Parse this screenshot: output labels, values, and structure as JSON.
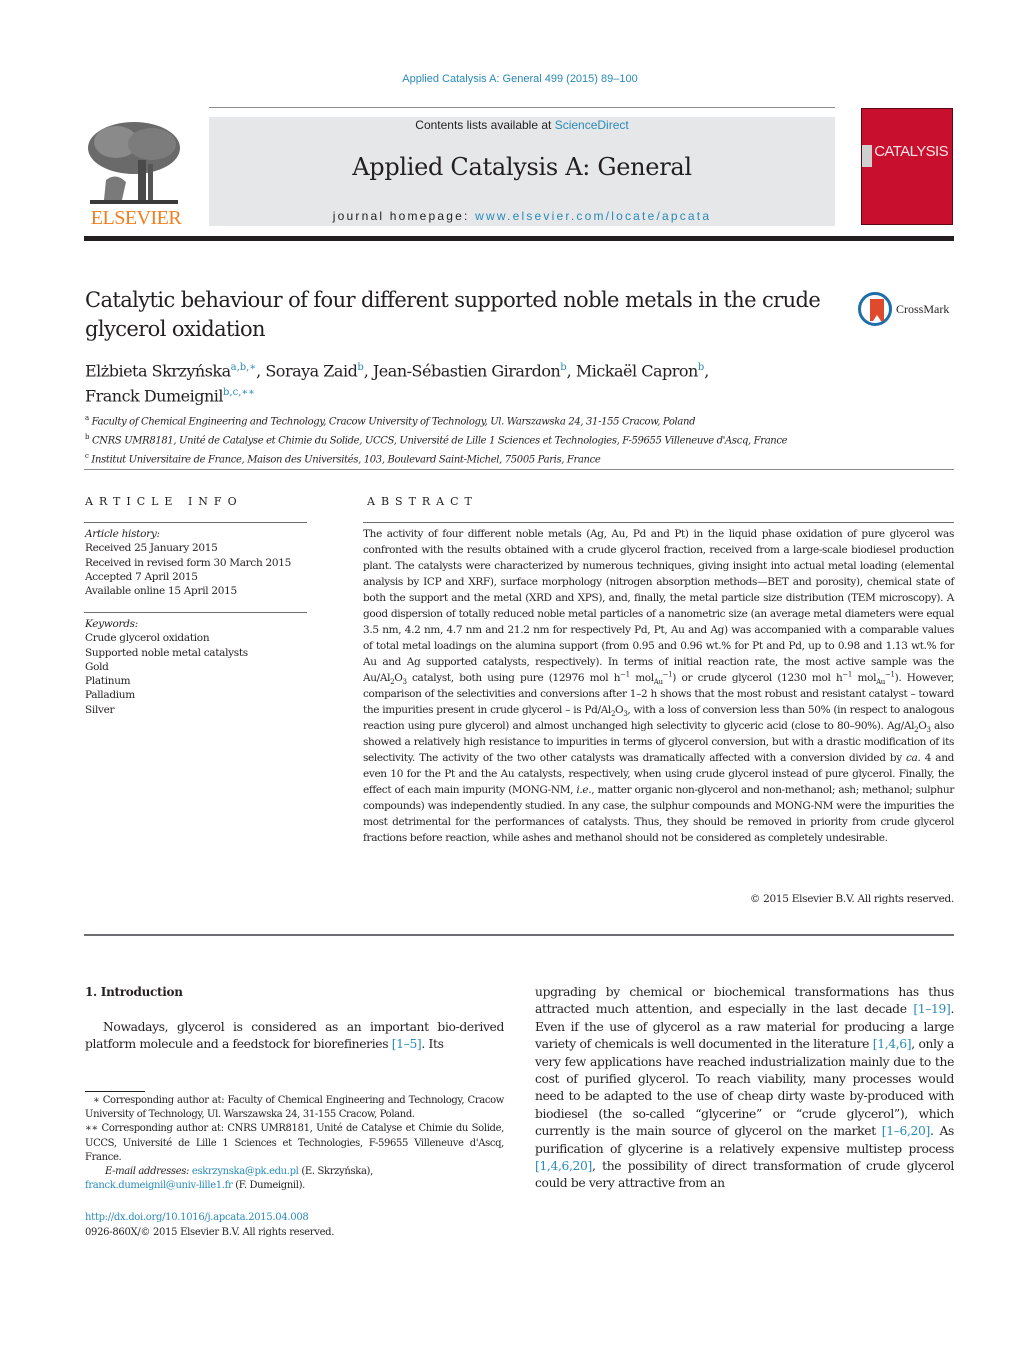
{
  "header": {
    "citation": "Applied Catalysis A: General 499 (2015) 89–100",
    "contents_prefix": "Contents lists available at ",
    "contents_link": "ScienceDirect",
    "journal_name": "Applied Catalysis A: General",
    "homepage_prefix": "journal homepage: ",
    "homepage_link": "www.elsevier.com/locate/apcata",
    "publisher_logo_text": "ELSEVIER",
    "cover_title": "CATALYSIS",
    "crossmark_label": "CrossMark"
  },
  "colors": {
    "link": "#2a8ab8",
    "elsevier_orange": "#f07f1d",
    "cover_red": "#c8102e",
    "band_gray": "#e6e7e8"
  },
  "article": {
    "title": "Catalytic behaviour of four different supported noble metals in the crude glycerol oxidation",
    "authors": [
      {
        "name": "Elżbieta Skrzyńska",
        "marks": "a,b,∗",
        "sep": ", "
      },
      {
        "name": "Soraya Zaid",
        "marks": "b",
        "sep": ", "
      },
      {
        "name": "Jean-Sébastien Girardon",
        "marks": "b",
        "sep": ", "
      },
      {
        "name": "Mickaël Capron",
        "marks": "b",
        "sep": ","
      },
      {
        "name": "Franck Dumeignil",
        "marks": "b,c,∗∗",
        "sep": ""
      }
    ],
    "affiliations": [
      {
        "mark": "a",
        "text": "Faculty of Chemical Engineering and Technology, Cracow University of Technology, Ul. Warszawska 24, 31-155 Cracow, Poland"
      },
      {
        "mark": "b",
        "text": "CNRS UMR8181, Unité de Catalyse et Chimie du Solide, UCCS, Université de Lille 1 Sciences et Technologies, F-59655 Villeneuve d'Ascq, France"
      },
      {
        "mark": "c",
        "text": "Institut Universitaire de France, Maison des Universités, 103, Boulevard Saint-Michel, 75005 Paris, France"
      }
    ]
  },
  "article_info": {
    "heading": "ARTICLE INFO",
    "history_label": "Article history:",
    "history": [
      "Received 25 January 2015",
      "Received in revised form 30 March 2015",
      "Accepted 7 April 2015",
      "Available online 15 April 2015"
    ],
    "keywords_label": "Keywords:",
    "keywords": [
      "Crude glycerol oxidation",
      "Supported noble metal catalysts",
      "Gold",
      "Platinum",
      "Palladium",
      "Silver"
    ]
  },
  "abstract": {
    "heading": "ABSTRACT",
    "p1": "The activity of four different noble metals (Ag, Au, Pd and Pt) in the liquid phase oxidation of pure glycerol was confronted with the results obtained with a crude glycerol fraction, received from a large-scale biodiesel production plant. The catalysts were characterized by numerous techniques, giving insight into actual metal loading (elemental analysis by ICP and XRF), surface morphology (nitrogen absorption methods—BET and porosity), chemical state of both the support and the metal (XRD and XPS), and, finally, the metal particle size distribution (TEM microscopy). A good dispersion of totally reduced noble metal particles of a nanometric size (an average metal diameters were equal 3.5 nm, 4.2 nm, 4.7 nm and 21.2 nm for respectively Pd, Pt, Au and Ag) was accompanied with a comparable values of total metal loadings on the alumina support (from 0.95 and 0.96 wt.% for Pt and Pd, up to 0.98 and 1.13 wt.% for Au and Ag supported catalysts, respectively). In terms of initial reaction rate, the most active sample was the ",
    "au_cat_a": "Au/Al",
    "sub2": "2",
    "o": "O",
    "sub3": "3",
    "p2": " catalyst, both using pure (12976 mol h",
    "neg1": "−1",
    "mol": " mol",
    "au_sub": "Au",
    "p3": ") or crude glycerol (1230 mol h",
    "p4": "). However, comparison of the selectivities and conversions after 1–2 h shows that the most robust and resistant catalyst – toward the impurities present in crude glycerol – is Pd/Al",
    "p5": ", with a loss of conversion less than 50% (in respect to analogous reaction using pure glycerol) and almost unchanged high selectivity to glyceric acid (close to 80–90%). Ag/Al",
    "p6": " also showed a relatively high resistance to impurities in terms of glycerol conversion, but with a drastic modification of its selectivity. The activity of the two other catalysts was dramatically affected with a conversion divided by ",
    "ca": "ca.",
    "p7": " 4 and even 10 for the Pt and the Au catalysts, respectively, when using crude glycerol instead of pure glycerol. Finally, the effect of each main impurity (MONG-NM, ",
    "ie": "i.e.",
    "p8": ", matter organic non-glycerol and non-methanol; ash; methanol; sulphur compounds) was independently studied. In any case, the sulphur compounds and MONG-NM were the impurities the most detrimental for the performances of catalysts. Thus, they should be removed in priority from crude glycerol fractions before reaction, while ashes and methanol should not be considered as completely undesirable.",
    "copyright": "© 2015 Elsevier B.V. All rights reserved."
  },
  "body": {
    "intro_heading": "1.  Introduction",
    "left_text": "Nowadays, glycerol is considered as an important bio-derived platform molecule and a feedstock for biorefineries ",
    "left_ref": "[1–5]",
    "left_end": ". Its",
    "right_1": "upgrading by chemical or biochemical transformations has thus attracted much attention, and especially in the last decade ",
    "right_ref1": "[1–19]",
    "right_2": ". Even if the use of glycerol as a raw material for producing a large variety of chemicals is well documented in the literature ",
    "right_ref2": "[1,4,6]",
    "right_3": ", only a very few applications have reached industrialization mainly due to the cost of purified glycerol. To reach viability, many processes would need to be adapted to the use of cheap dirty waste by-produced with biodiesel (the so-called “glycerine” or “crude glycerol”), which currently is the main source of glycerol on the market ",
    "right_ref3": "[1–6,20]",
    "right_4": ". As purification of glycerine is a relatively expensive multistep process ",
    "right_ref4": "[1,4,6,20]",
    "right_5": ", the possibility of direct transformation of crude glycerol could be very attractive from an"
  },
  "footnotes": {
    "fn1": "∗ Corresponding author at: Faculty of Chemical Engineering and Technology, Cracow University of Technology, Ul. Warszawska 24, 31-155 Cracow, Poland.",
    "fn2": "∗∗ Corresponding author at: CNRS UMR8181, Unité de Catalyse et Chimie du Solide, UCCS, Université de Lille 1 Sciences et Technologies, F-59655 Villeneuve d'Ascq, France.",
    "email_label": "E-mail addresses: ",
    "email1": "eskrzynska@pk.edu.pl",
    "email1_owner": " (E. Skrzyńska),",
    "email2": "franck.dumeignil@univ-lille1.fr",
    "email2_owner": " (F. Dumeignil).",
    "doi": "http://dx.doi.org/10.1016/j.apcata.2015.04.008",
    "issn": "0926-860X/© 2015 Elsevier B.V. All rights reserved."
  }
}
